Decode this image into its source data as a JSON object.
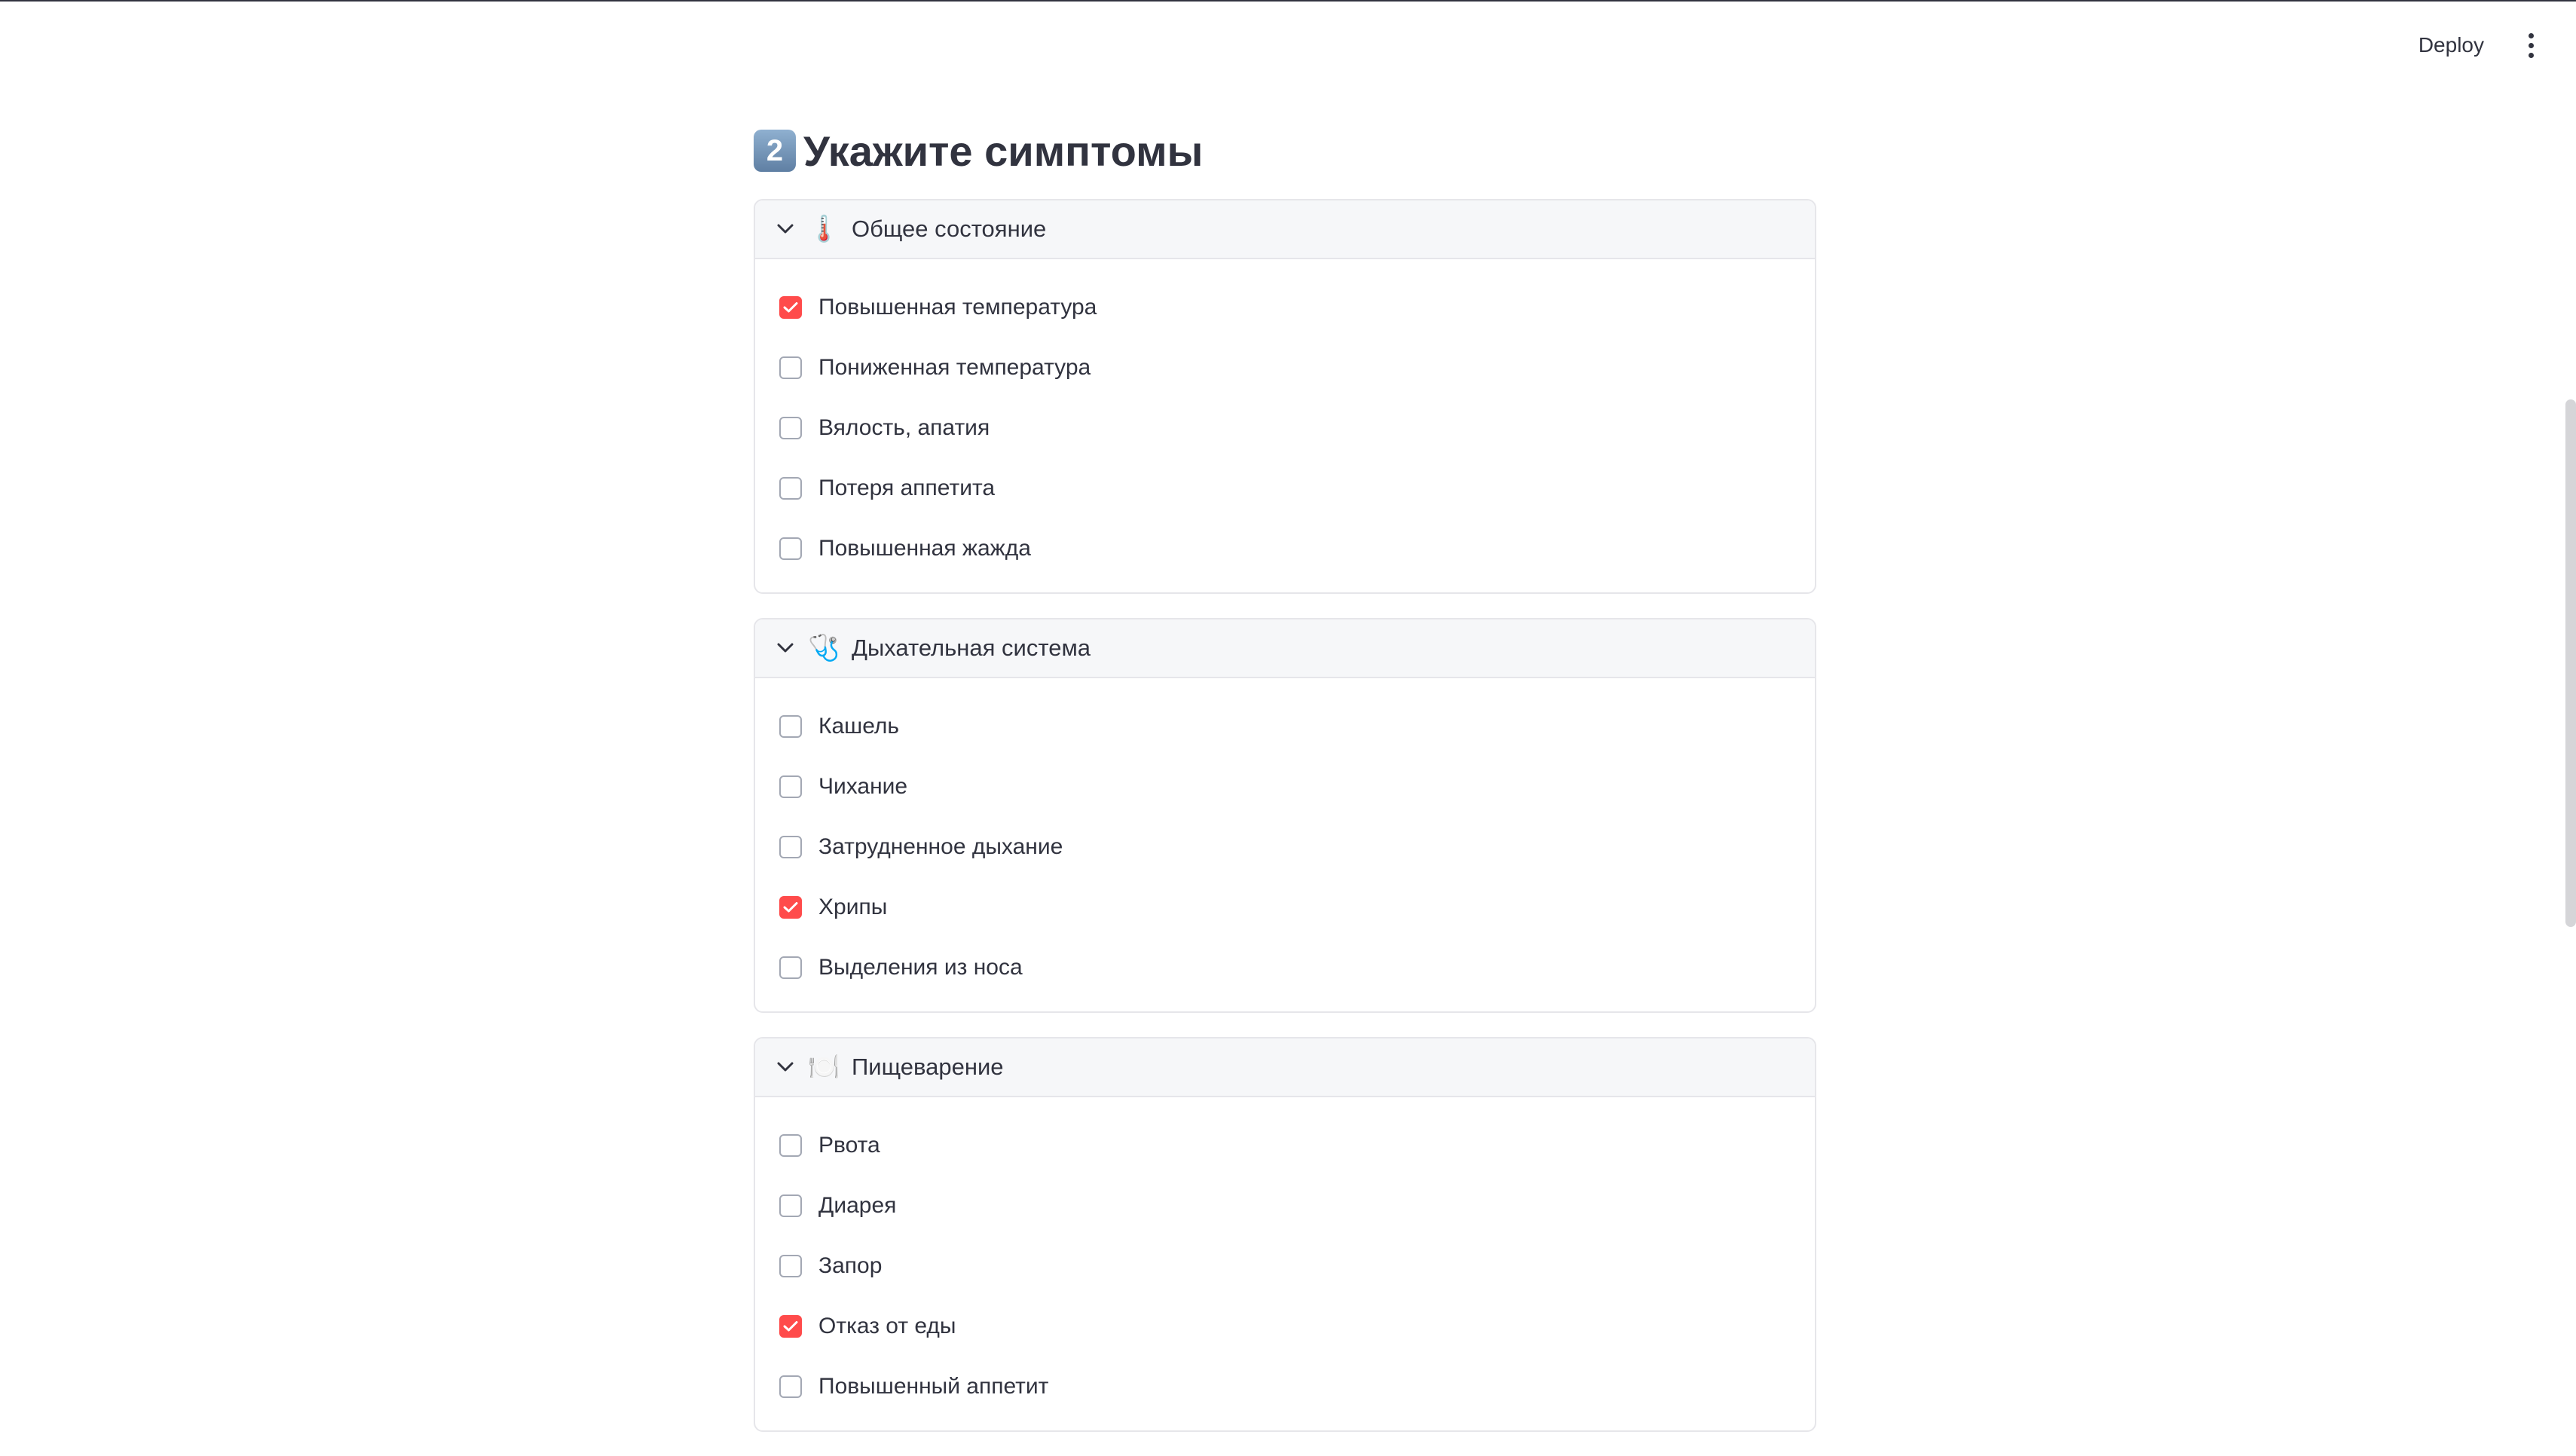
{
  "toolbar": {
    "deploy_label": "Deploy"
  },
  "page": {
    "title_number": "2",
    "title": "Укажите симптомы"
  },
  "sections": [
    {
      "emoji": "🌡️",
      "title": "Общее состояние",
      "items": [
        {
          "label": "Повышенная температура",
          "checked": true
        },
        {
          "label": "Пониженная температура",
          "checked": false
        },
        {
          "label": "Вялость, апатия",
          "checked": false
        },
        {
          "label": "Потеря аппетита",
          "checked": false
        },
        {
          "label": "Повышенная жажда",
          "checked": false
        }
      ]
    },
    {
      "emoji": "🩺",
      "title": "Дыхательная система",
      "items": [
        {
          "label": "Кашель",
          "checked": false
        },
        {
          "label": "Чихание",
          "checked": false
        },
        {
          "label": "Затрудненное дыхание",
          "checked": false
        },
        {
          "label": "Хрипы",
          "checked": true
        },
        {
          "label": "Выделения из носа",
          "checked": false
        }
      ]
    },
    {
      "emoji": "🍽️",
      "title": "Пищеварение",
      "items": [
        {
          "label": "Рвота",
          "checked": false
        },
        {
          "label": "Диарея",
          "checked": false
        },
        {
          "label": "Запор",
          "checked": false
        },
        {
          "label": "Отказ от еды",
          "checked": true
        },
        {
          "label": "Повышенный аппетит",
          "checked": false
        }
      ]
    }
  ],
  "colors": {
    "accent": "#ff4b4b",
    "text": "#31333f",
    "border": "#e6e6ea"
  }
}
